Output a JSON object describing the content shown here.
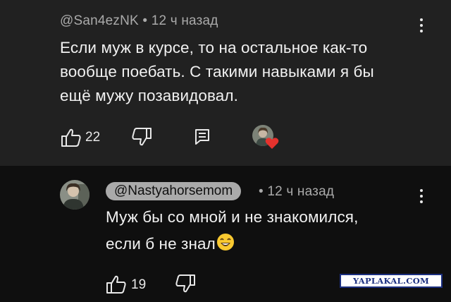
{
  "comment1": {
    "meta": "@San4ezNK • 12 ч назад",
    "lines": [
      "Если муж в курсе, то на остальное как-то",
      "вообще поебать. С такими навыками я бы",
      "ещё мужу позавидовал."
    ],
    "likes": "22"
  },
  "comment2": {
    "author": "@Nastyahorsemom",
    "time": "• 12 ч назад",
    "lines": [
      "Муж бы со мной и не знакомился,",
      "если б не знал"
    ],
    "likes": "19"
  },
  "watermark": "YAPLAKAL.COM",
  "icons": [
    "thumbs-up-icon",
    "thumbs-down-icon",
    "reply-icon",
    "more-vert-icon",
    "heart-icon",
    "smile-emoji"
  ],
  "colors": {
    "surface": "#212121",
    "background": "#0f0f0f",
    "secondary_text": "#aaaaaa",
    "heart": "#e5322d"
  }
}
